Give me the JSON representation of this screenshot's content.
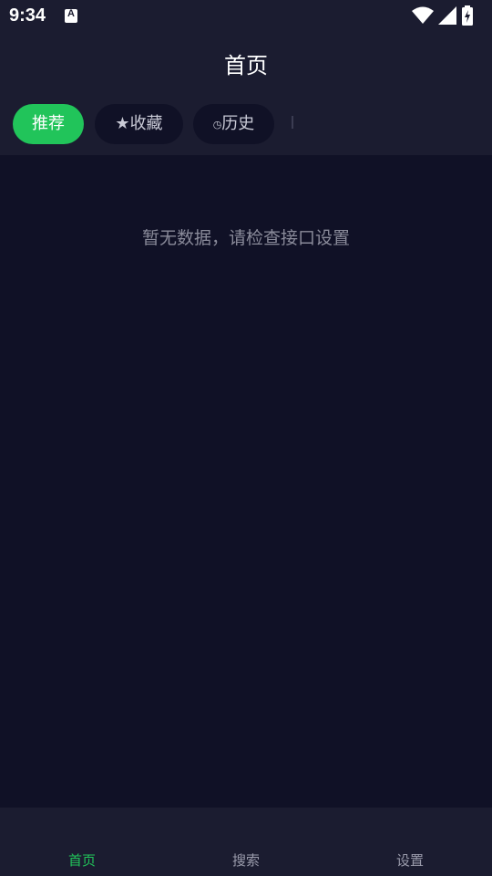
{
  "status_bar": {
    "time": "9:34",
    "notification_icon_letter": "A",
    "icons": [
      "wifi-icon",
      "signal-icon",
      "battery-charging-icon"
    ]
  },
  "header": {
    "title": "首页"
  },
  "tabs": [
    {
      "label": "推荐",
      "icon": "",
      "active": true
    },
    {
      "label": "收藏",
      "icon": "★",
      "icon_name": "star-icon",
      "active": false
    },
    {
      "label": "历史",
      "icon": "◷",
      "icon_name": "clock-icon",
      "active": false
    }
  ],
  "content": {
    "empty_message": "暂无数据，请检查接口设置"
  },
  "bottom_nav": [
    {
      "label": "首页",
      "active": true
    },
    {
      "label": "搜索",
      "active": false
    },
    {
      "label": "设置",
      "active": false
    }
  ],
  "colors": {
    "accent": "#21c45a",
    "background": "#101126",
    "surface": "#1b1c30",
    "text_muted": "#8a8b9a"
  }
}
